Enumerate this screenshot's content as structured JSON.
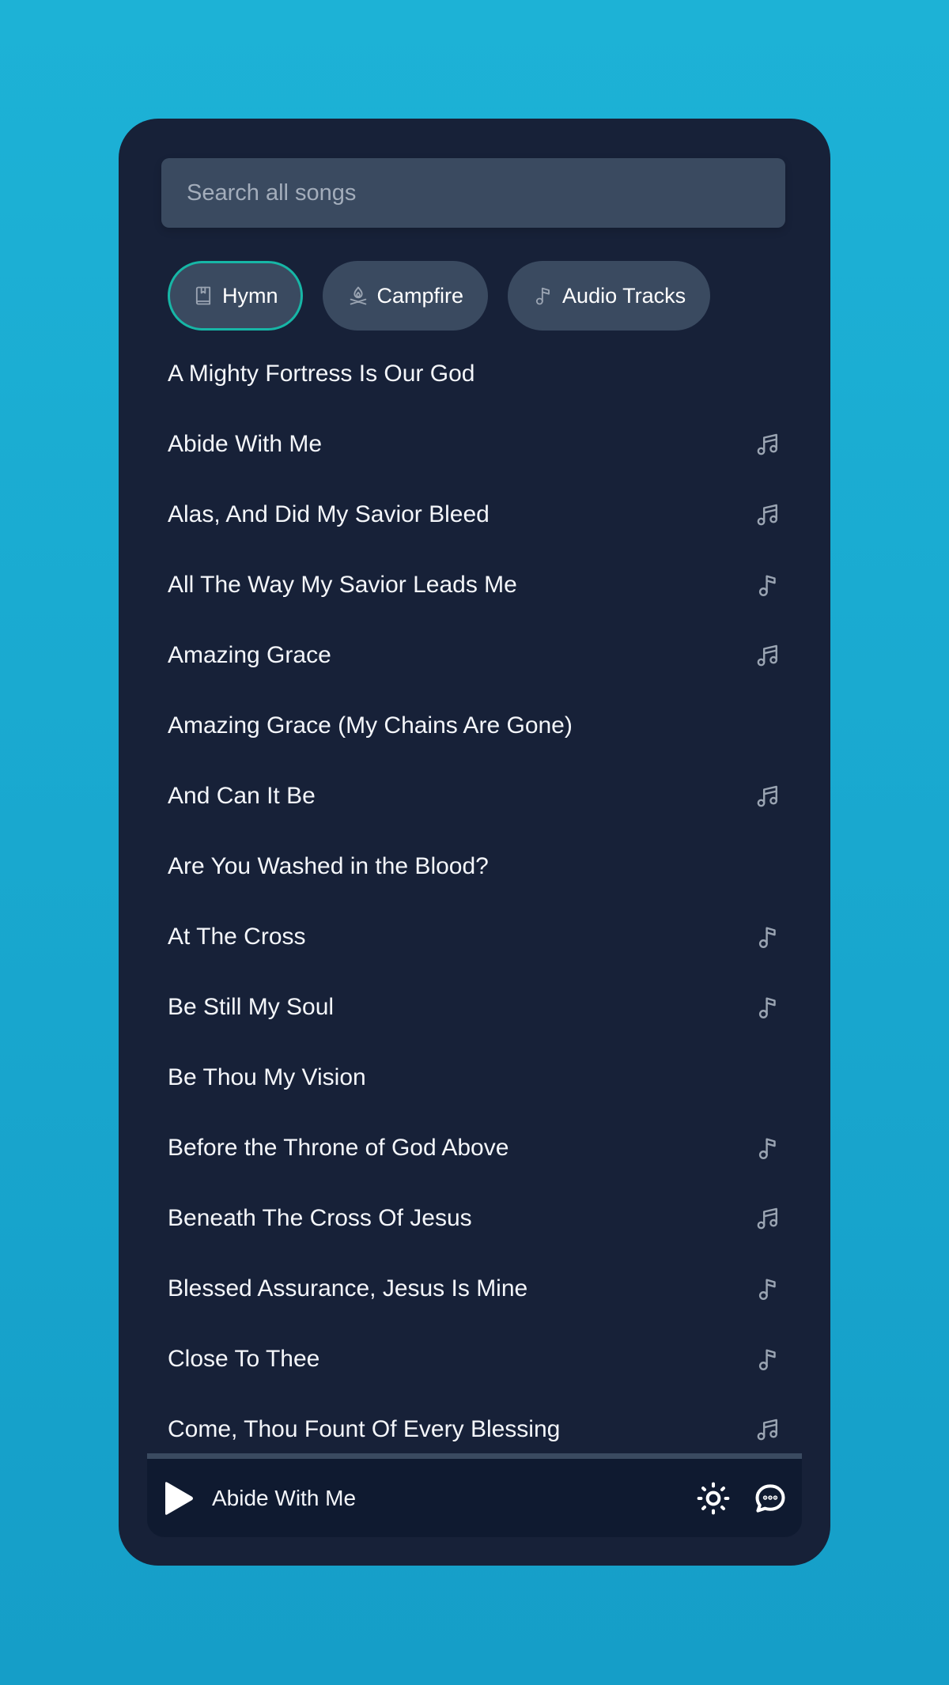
{
  "colors": {
    "background": "#1db2d6",
    "card": "#172138",
    "surface": "#3a4a60",
    "accent": "#17b6a6",
    "player": "#0f1a30",
    "icon_muted": "#9aa4b2"
  },
  "search": {
    "placeholder": "Search all songs",
    "value": ""
  },
  "filters": [
    {
      "label": "Hymn",
      "icon": "book-icon",
      "active": true
    },
    {
      "label": "Campfire",
      "icon": "campfire-icon",
      "active": false
    },
    {
      "label": "Audio Tracks",
      "icon": "music-note-icon",
      "active": false
    }
  ],
  "songs": [
    {
      "title": "A Mighty Fortress Is Our God",
      "icon": "none"
    },
    {
      "title": "Abide With Me",
      "icon": "music-notes-icon"
    },
    {
      "title": "Alas, And Did My Savior Bleed",
      "icon": "music-notes-icon"
    },
    {
      "title": "All The Way My Savior Leads Me",
      "icon": "music-note-icon"
    },
    {
      "title": "Amazing Grace",
      "icon": "music-notes-icon"
    },
    {
      "title": "Amazing Grace (My Chains Are Gone)",
      "icon": "none"
    },
    {
      "title": "And Can It Be",
      "icon": "music-notes-icon"
    },
    {
      "title": "Are You Washed in the Blood?",
      "icon": "none"
    },
    {
      "title": "At The Cross",
      "icon": "music-note-icon"
    },
    {
      "title": "Be Still My Soul",
      "icon": "music-note-icon"
    },
    {
      "title": "Be Thou My Vision",
      "icon": "none"
    },
    {
      "title": "Before the Throne of God Above",
      "icon": "music-note-icon"
    },
    {
      "title": "Beneath The Cross Of Jesus",
      "icon": "music-notes-icon"
    },
    {
      "title": "Blessed Assurance, Jesus Is Mine",
      "icon": "music-note-icon"
    },
    {
      "title": "Close To Thee",
      "icon": "music-note-icon"
    },
    {
      "title": "Come, Thou Fount Of Every Blessing",
      "icon": "music-notes-icon"
    }
  ],
  "player": {
    "now_playing": "Abide With Me",
    "play_icon": "play-icon",
    "theme_icon": "sun-icon",
    "chat_icon": "chat-bubble-icon"
  }
}
